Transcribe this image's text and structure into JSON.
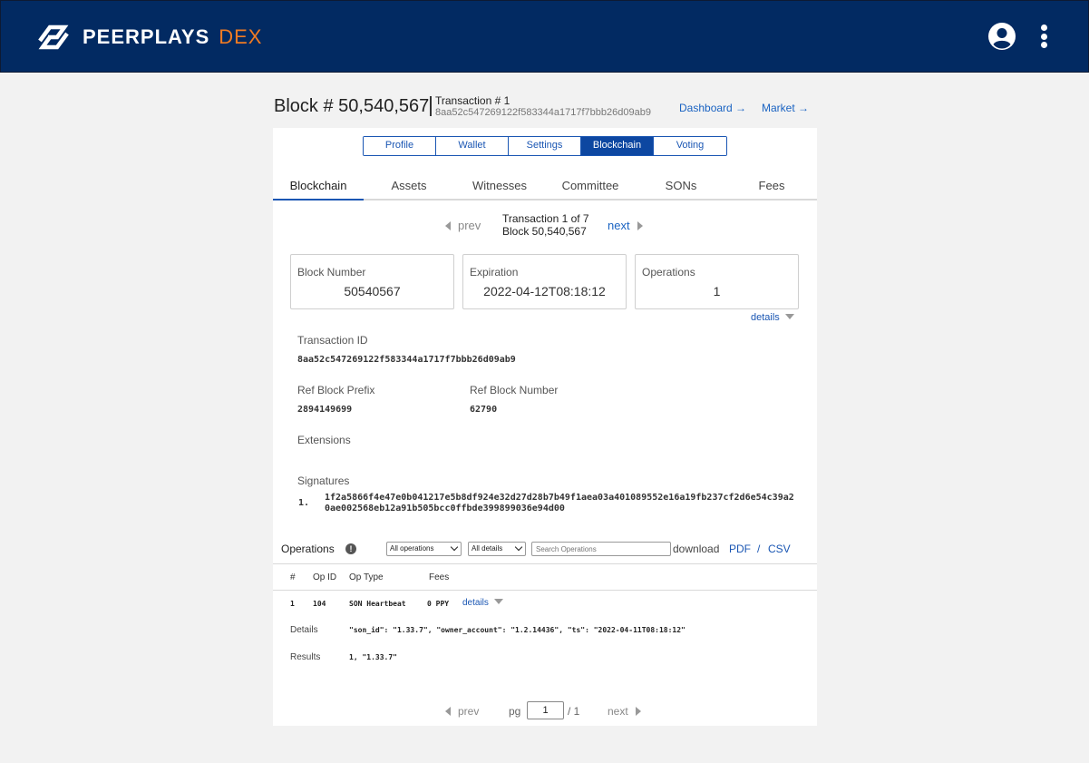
{
  "app": {
    "brand": "PEERPLAYS",
    "brand_suffix": "DEX"
  },
  "header": {
    "block_title": "Block # 50,540,567",
    "tx_title": "Transaction # 1",
    "tx_hash": "8aa52c547269122f583344a1717f7bbb26d09ab9",
    "dashboard_link": "Dashboard →",
    "market_link": "Market →"
  },
  "main_tabs": [
    {
      "label": "Profile"
    },
    {
      "label": "Wallet"
    },
    {
      "label": "Settings"
    },
    {
      "label": "Blockchain",
      "active": true
    },
    {
      "label": "Voting"
    }
  ],
  "sub_tabs": [
    {
      "label": "Blockchain",
      "active": true
    },
    {
      "label": "Assets"
    },
    {
      "label": "Witnesses"
    },
    {
      "label": "Committee"
    },
    {
      "label": "SONs"
    },
    {
      "label": "Fees"
    }
  ],
  "pager": {
    "prev": "prev",
    "next": "next",
    "line1": "Transaction 1 of 7",
    "line2": "Block 50,540,567"
  },
  "stats": [
    {
      "label": "Block Number",
      "value": "50540567"
    },
    {
      "label": "Expiration",
      "value": "2022-04-12T08:18:12"
    },
    {
      "label": "Operations",
      "value": "1"
    }
  ],
  "details_toggle": "details",
  "tx_fields": {
    "txid_label": "Transaction ID",
    "txid_value": "8aa52c547269122f583344a1717f7bbb26d09ab9",
    "ref_prefix_label": "Ref Block Prefix",
    "ref_prefix_value": "2894149699",
    "ref_number_label": "Ref Block Number",
    "ref_number_value": "62790",
    "extensions_label": "Extensions",
    "signatures_label": "Signatures",
    "signature_index": "1.",
    "signature_value": "1f2a5866f4e47e0b041217e5b8df924e32d27d28b7b49f1aea03a401089552e16a19fb237cf2d6e54c39a20ae002568eb12a91b505bcc0ffbde399899036e94d00"
  },
  "operations": {
    "title": "Operations",
    "filter_ops": "All operations",
    "filter_details": "All details",
    "search_placeholder": "Search Operations",
    "download_label": "download",
    "pdf": "PDF",
    "slash": "/",
    "csv": "CSV",
    "columns": [
      "#",
      "Op ID",
      "Op Type",
      "Fees"
    ],
    "row": {
      "num": "1",
      "op_id": "104",
      "op_type": "SON Heartbeat",
      "fee": "0 PPY",
      "details_link": "details",
      "details_label": "Details",
      "details_value": "\"son_id\": \"1.33.7\", \"owner_account\": \"1.2.14436\", \"ts\": \"2022-04-11T08:18:12\"",
      "results_label": "Results",
      "results_value": "1, \"1.33.7\""
    }
  },
  "bottom_pager": {
    "prev": "prev",
    "pg": "pg",
    "page": "1",
    "of": "/ 1",
    "next": "next"
  },
  "colors": {
    "topbar": "#022a62",
    "accent": "#1a56b3",
    "brand_orange": "#f07b23"
  }
}
